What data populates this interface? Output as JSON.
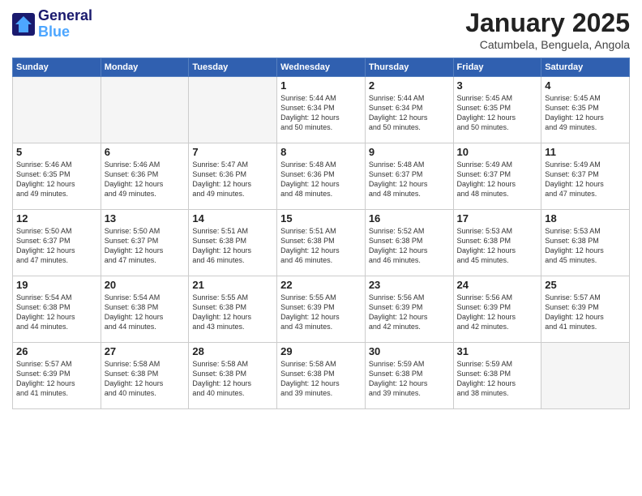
{
  "header": {
    "logo_line1": "General",
    "logo_line2": "Blue",
    "month": "January 2025",
    "location": "Catumbela, Benguela, Angola"
  },
  "weekdays": [
    "Sunday",
    "Monday",
    "Tuesday",
    "Wednesday",
    "Thursday",
    "Friday",
    "Saturday"
  ],
  "weeks": [
    [
      {
        "day": "",
        "info": ""
      },
      {
        "day": "",
        "info": ""
      },
      {
        "day": "",
        "info": ""
      },
      {
        "day": "1",
        "info": "Sunrise: 5:44 AM\nSunset: 6:34 PM\nDaylight: 12 hours\nand 50 minutes."
      },
      {
        "day": "2",
        "info": "Sunrise: 5:44 AM\nSunset: 6:34 PM\nDaylight: 12 hours\nand 50 minutes."
      },
      {
        "day": "3",
        "info": "Sunrise: 5:45 AM\nSunset: 6:35 PM\nDaylight: 12 hours\nand 50 minutes."
      },
      {
        "day": "4",
        "info": "Sunrise: 5:45 AM\nSunset: 6:35 PM\nDaylight: 12 hours\nand 49 minutes."
      }
    ],
    [
      {
        "day": "5",
        "info": "Sunrise: 5:46 AM\nSunset: 6:35 PM\nDaylight: 12 hours\nand 49 minutes."
      },
      {
        "day": "6",
        "info": "Sunrise: 5:46 AM\nSunset: 6:36 PM\nDaylight: 12 hours\nand 49 minutes."
      },
      {
        "day": "7",
        "info": "Sunrise: 5:47 AM\nSunset: 6:36 PM\nDaylight: 12 hours\nand 49 minutes."
      },
      {
        "day": "8",
        "info": "Sunrise: 5:48 AM\nSunset: 6:36 PM\nDaylight: 12 hours\nand 48 minutes."
      },
      {
        "day": "9",
        "info": "Sunrise: 5:48 AM\nSunset: 6:37 PM\nDaylight: 12 hours\nand 48 minutes."
      },
      {
        "day": "10",
        "info": "Sunrise: 5:49 AM\nSunset: 6:37 PM\nDaylight: 12 hours\nand 48 minutes."
      },
      {
        "day": "11",
        "info": "Sunrise: 5:49 AM\nSunset: 6:37 PM\nDaylight: 12 hours\nand 47 minutes."
      }
    ],
    [
      {
        "day": "12",
        "info": "Sunrise: 5:50 AM\nSunset: 6:37 PM\nDaylight: 12 hours\nand 47 minutes."
      },
      {
        "day": "13",
        "info": "Sunrise: 5:50 AM\nSunset: 6:37 PM\nDaylight: 12 hours\nand 47 minutes."
      },
      {
        "day": "14",
        "info": "Sunrise: 5:51 AM\nSunset: 6:38 PM\nDaylight: 12 hours\nand 46 minutes."
      },
      {
        "day": "15",
        "info": "Sunrise: 5:51 AM\nSunset: 6:38 PM\nDaylight: 12 hours\nand 46 minutes."
      },
      {
        "day": "16",
        "info": "Sunrise: 5:52 AM\nSunset: 6:38 PM\nDaylight: 12 hours\nand 46 minutes."
      },
      {
        "day": "17",
        "info": "Sunrise: 5:53 AM\nSunset: 6:38 PM\nDaylight: 12 hours\nand 45 minutes."
      },
      {
        "day": "18",
        "info": "Sunrise: 5:53 AM\nSunset: 6:38 PM\nDaylight: 12 hours\nand 45 minutes."
      }
    ],
    [
      {
        "day": "19",
        "info": "Sunrise: 5:54 AM\nSunset: 6:38 PM\nDaylight: 12 hours\nand 44 minutes."
      },
      {
        "day": "20",
        "info": "Sunrise: 5:54 AM\nSunset: 6:38 PM\nDaylight: 12 hours\nand 44 minutes."
      },
      {
        "day": "21",
        "info": "Sunrise: 5:55 AM\nSunset: 6:38 PM\nDaylight: 12 hours\nand 43 minutes."
      },
      {
        "day": "22",
        "info": "Sunrise: 5:55 AM\nSunset: 6:39 PM\nDaylight: 12 hours\nand 43 minutes."
      },
      {
        "day": "23",
        "info": "Sunrise: 5:56 AM\nSunset: 6:39 PM\nDaylight: 12 hours\nand 42 minutes."
      },
      {
        "day": "24",
        "info": "Sunrise: 5:56 AM\nSunset: 6:39 PM\nDaylight: 12 hours\nand 42 minutes."
      },
      {
        "day": "25",
        "info": "Sunrise: 5:57 AM\nSunset: 6:39 PM\nDaylight: 12 hours\nand 41 minutes."
      }
    ],
    [
      {
        "day": "26",
        "info": "Sunrise: 5:57 AM\nSunset: 6:39 PM\nDaylight: 12 hours\nand 41 minutes."
      },
      {
        "day": "27",
        "info": "Sunrise: 5:58 AM\nSunset: 6:38 PM\nDaylight: 12 hours\nand 40 minutes."
      },
      {
        "day": "28",
        "info": "Sunrise: 5:58 AM\nSunset: 6:38 PM\nDaylight: 12 hours\nand 40 minutes."
      },
      {
        "day": "29",
        "info": "Sunrise: 5:58 AM\nSunset: 6:38 PM\nDaylight: 12 hours\nand 39 minutes."
      },
      {
        "day": "30",
        "info": "Sunrise: 5:59 AM\nSunset: 6:38 PM\nDaylight: 12 hours\nand 39 minutes."
      },
      {
        "day": "31",
        "info": "Sunrise: 5:59 AM\nSunset: 6:38 PM\nDaylight: 12 hours\nand 38 minutes."
      },
      {
        "day": "",
        "info": ""
      }
    ]
  ]
}
